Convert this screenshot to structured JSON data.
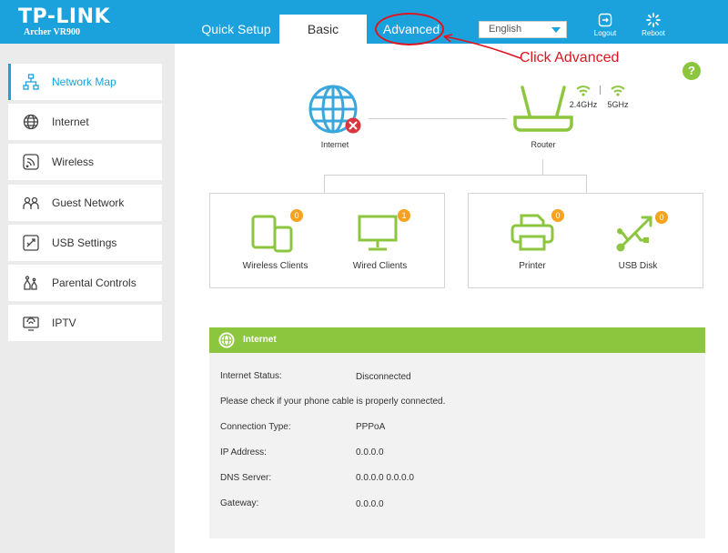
{
  "brand": {
    "logo": "TP-LINK",
    "model": "Archer VR900"
  },
  "nav": {
    "quick_setup": "Quick Setup",
    "basic": "Basic",
    "advanced": "Advanced"
  },
  "language": {
    "selected": "English"
  },
  "header_buttons": {
    "logout": "Logout",
    "reboot": "Reboot"
  },
  "annotation": {
    "text": "Click Advanced"
  },
  "help": {
    "label": "?"
  },
  "sidebar": {
    "items": [
      {
        "label": "Network Map",
        "icon": "network-map-icon",
        "active": true
      },
      {
        "label": "Internet",
        "icon": "globe-icon"
      },
      {
        "label": "Wireless",
        "icon": "wireless-icon"
      },
      {
        "label": "Guest Network",
        "icon": "guest-network-icon"
      },
      {
        "label": "USB Settings",
        "icon": "usb-icon"
      },
      {
        "label": "Parental Controls",
        "icon": "parental-controls-icon"
      },
      {
        "label": "IPTV",
        "icon": "tv-icon"
      }
    ]
  },
  "map": {
    "internet_label": "Internet",
    "router_label": "Router",
    "band_24": "2.4GHz",
    "band_5": "5GHz",
    "wireless_clients": {
      "label": "Wireless Clients",
      "count": "0"
    },
    "wired_clients": {
      "label": "Wired Clients",
      "count": "1"
    },
    "printer": {
      "label": "Printer",
      "count": "0"
    },
    "usb_disk": {
      "label": "USB Disk",
      "count": "0"
    }
  },
  "internet_panel": {
    "title": "Internet",
    "status_key": "Internet Status:",
    "status_val": "Disconnected",
    "notice": "Please check if your phone cable is properly connected.",
    "conn_key": "Connection Type:",
    "conn_val": "PPPoA",
    "ip_key": "IP Address:",
    "ip_val": "0.0.0.0",
    "dns_key": "DNS Server:",
    "dns_val": "0.0.0.0 0.0.0.0",
    "gw_key": "Gateway:",
    "gw_val": "0.0.0.0"
  },
  "colors": {
    "header": "#1ba2dc",
    "accent_green": "#8cc63f",
    "badge": "#f7a21d",
    "error": "#e0141e"
  }
}
